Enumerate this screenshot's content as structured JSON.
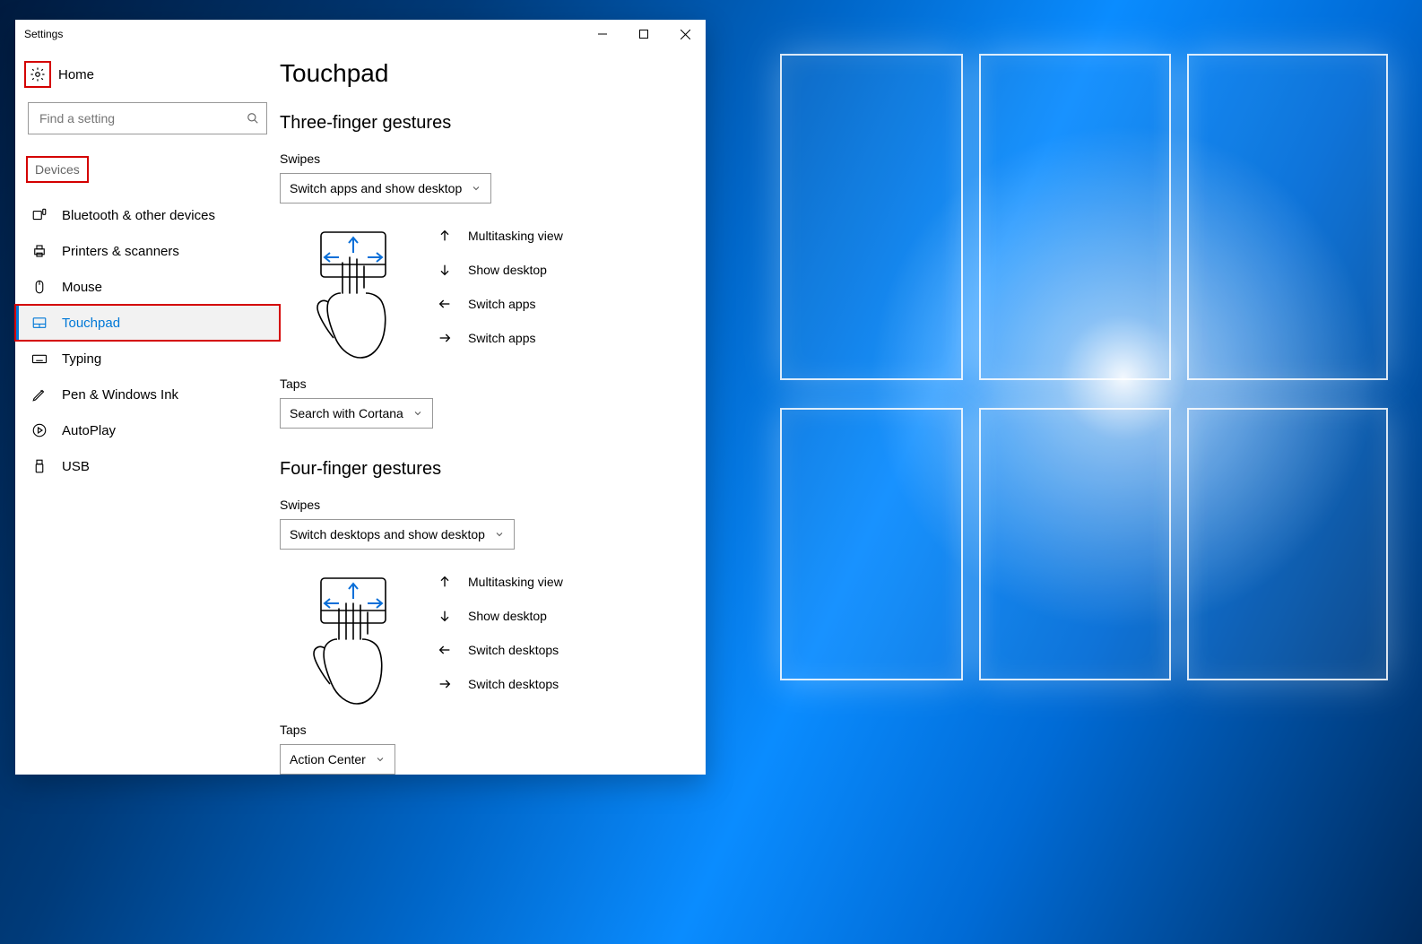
{
  "window": {
    "title": "Settings"
  },
  "sidebar": {
    "home": "Home",
    "search_placeholder": "Find a setting",
    "category": "Devices",
    "items": [
      {
        "label": "Bluetooth & other devices"
      },
      {
        "label": "Printers & scanners"
      },
      {
        "label": "Mouse"
      },
      {
        "label": "Touchpad"
      },
      {
        "label": "Typing"
      },
      {
        "label": "Pen & Windows Ink"
      },
      {
        "label": "AutoPlay"
      },
      {
        "label": "USB"
      }
    ]
  },
  "main": {
    "title": "Touchpad",
    "three": {
      "heading": "Three-finger gestures",
      "swipes_label": "Swipes",
      "swipes_value": "Switch apps and show desktop",
      "legend": {
        "up": "Multitasking view",
        "down": "Show desktop",
        "left": "Switch apps",
        "right": "Switch apps"
      },
      "taps_label": "Taps",
      "taps_value": "Search with Cortana"
    },
    "four": {
      "heading": "Four-finger gestures",
      "swipes_label": "Swipes",
      "swipes_value": "Switch desktops and show desktop",
      "legend": {
        "up": "Multitasking view",
        "down": "Show desktop",
        "left": "Switch desktops",
        "right": "Switch desktops"
      },
      "taps_label": "Taps",
      "taps_value": "Action Center"
    }
  }
}
